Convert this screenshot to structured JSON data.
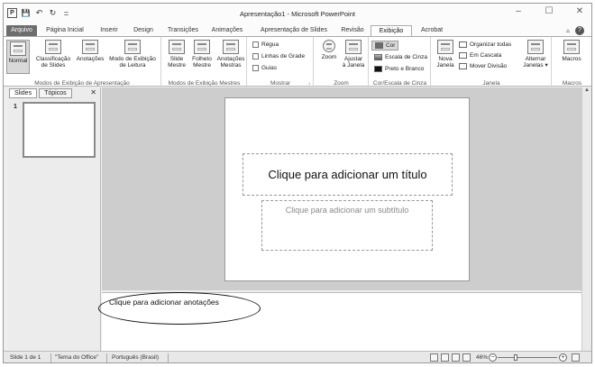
{
  "window": {
    "title": "Apresentação1 - Microsoft PowerPoint",
    "controls": {
      "minimize": "–",
      "maximize": "☐",
      "close": "✕"
    }
  },
  "qat": {
    "app_icon": "P",
    "save": "💾",
    "undo": "↶",
    "redo": "↻",
    "customize": "="
  },
  "tabs": [
    {
      "label": "Arquivo"
    },
    {
      "label": "Página Inicial"
    },
    {
      "label": "Inserir"
    },
    {
      "label": "Design"
    },
    {
      "label": "Transições"
    },
    {
      "label": "Animações"
    },
    {
      "label": "Apresentação de Slides"
    },
    {
      "label": "Revisão"
    },
    {
      "label": "Exibição"
    },
    {
      "label": "Acrobat"
    }
  ],
  "active_tab": "Exibição",
  "tabs_right": {
    "collapse": "▵",
    "help": "?"
  },
  "ribbon": {
    "modos_apresentacao": {
      "label": "Modos de Exibição de Apresentação",
      "buttons": [
        {
          "label": "Normal"
        },
        {
          "label": "Classificação\nde Slides"
        },
        {
          "label": "Anotações"
        },
        {
          "label": "Modo de Exibição\nde Leitura"
        }
      ]
    },
    "modos_mestres": {
      "label": "Modos de Exibição Mestres",
      "buttons": [
        {
          "label": "Slide\nMestre"
        },
        {
          "label": "Folheto\nMestre"
        },
        {
          "label": "Anotações\nMestras"
        }
      ]
    },
    "mostrar": {
      "label": "Mostrar",
      "items": [
        "Régua",
        "Linhas de Grade",
        "Guias"
      ]
    },
    "zoom": {
      "label": "Zoom",
      "buttons": [
        {
          "label": "Zoom"
        },
        {
          "label": "Ajustar\nà Janela"
        }
      ]
    },
    "cor": {
      "label": "Cor/Escala de Cinza",
      "items": [
        "Cor",
        "Escala de Cinza",
        "Preto e Branco"
      ]
    },
    "janela": {
      "label": "Janela",
      "new_window": "Nova\nJanela",
      "items": [
        "Organizar todas",
        "Em Cascata",
        "Mover Divisão"
      ],
      "switch": "Alternar\nJanelas ▾"
    },
    "macros": {
      "label": "Macros",
      "button": "Macros"
    }
  },
  "left_pane": {
    "tabs": [
      "Slides",
      "Tópicos"
    ],
    "close": "✕",
    "slide_number": "1"
  },
  "slide": {
    "title_placeholder": "Clique para adicionar um título",
    "subtitle_placeholder": "Clique para adicionar um subtítulo"
  },
  "notes": {
    "placeholder": "Clique para adicionar anotações"
  },
  "status": {
    "slide": "Slide 1 de 1",
    "theme": "\"Tema do Office\"",
    "language": "Português (Brasil)",
    "zoom": "46%",
    "zoom_minus": "−",
    "zoom_plus": "+"
  }
}
